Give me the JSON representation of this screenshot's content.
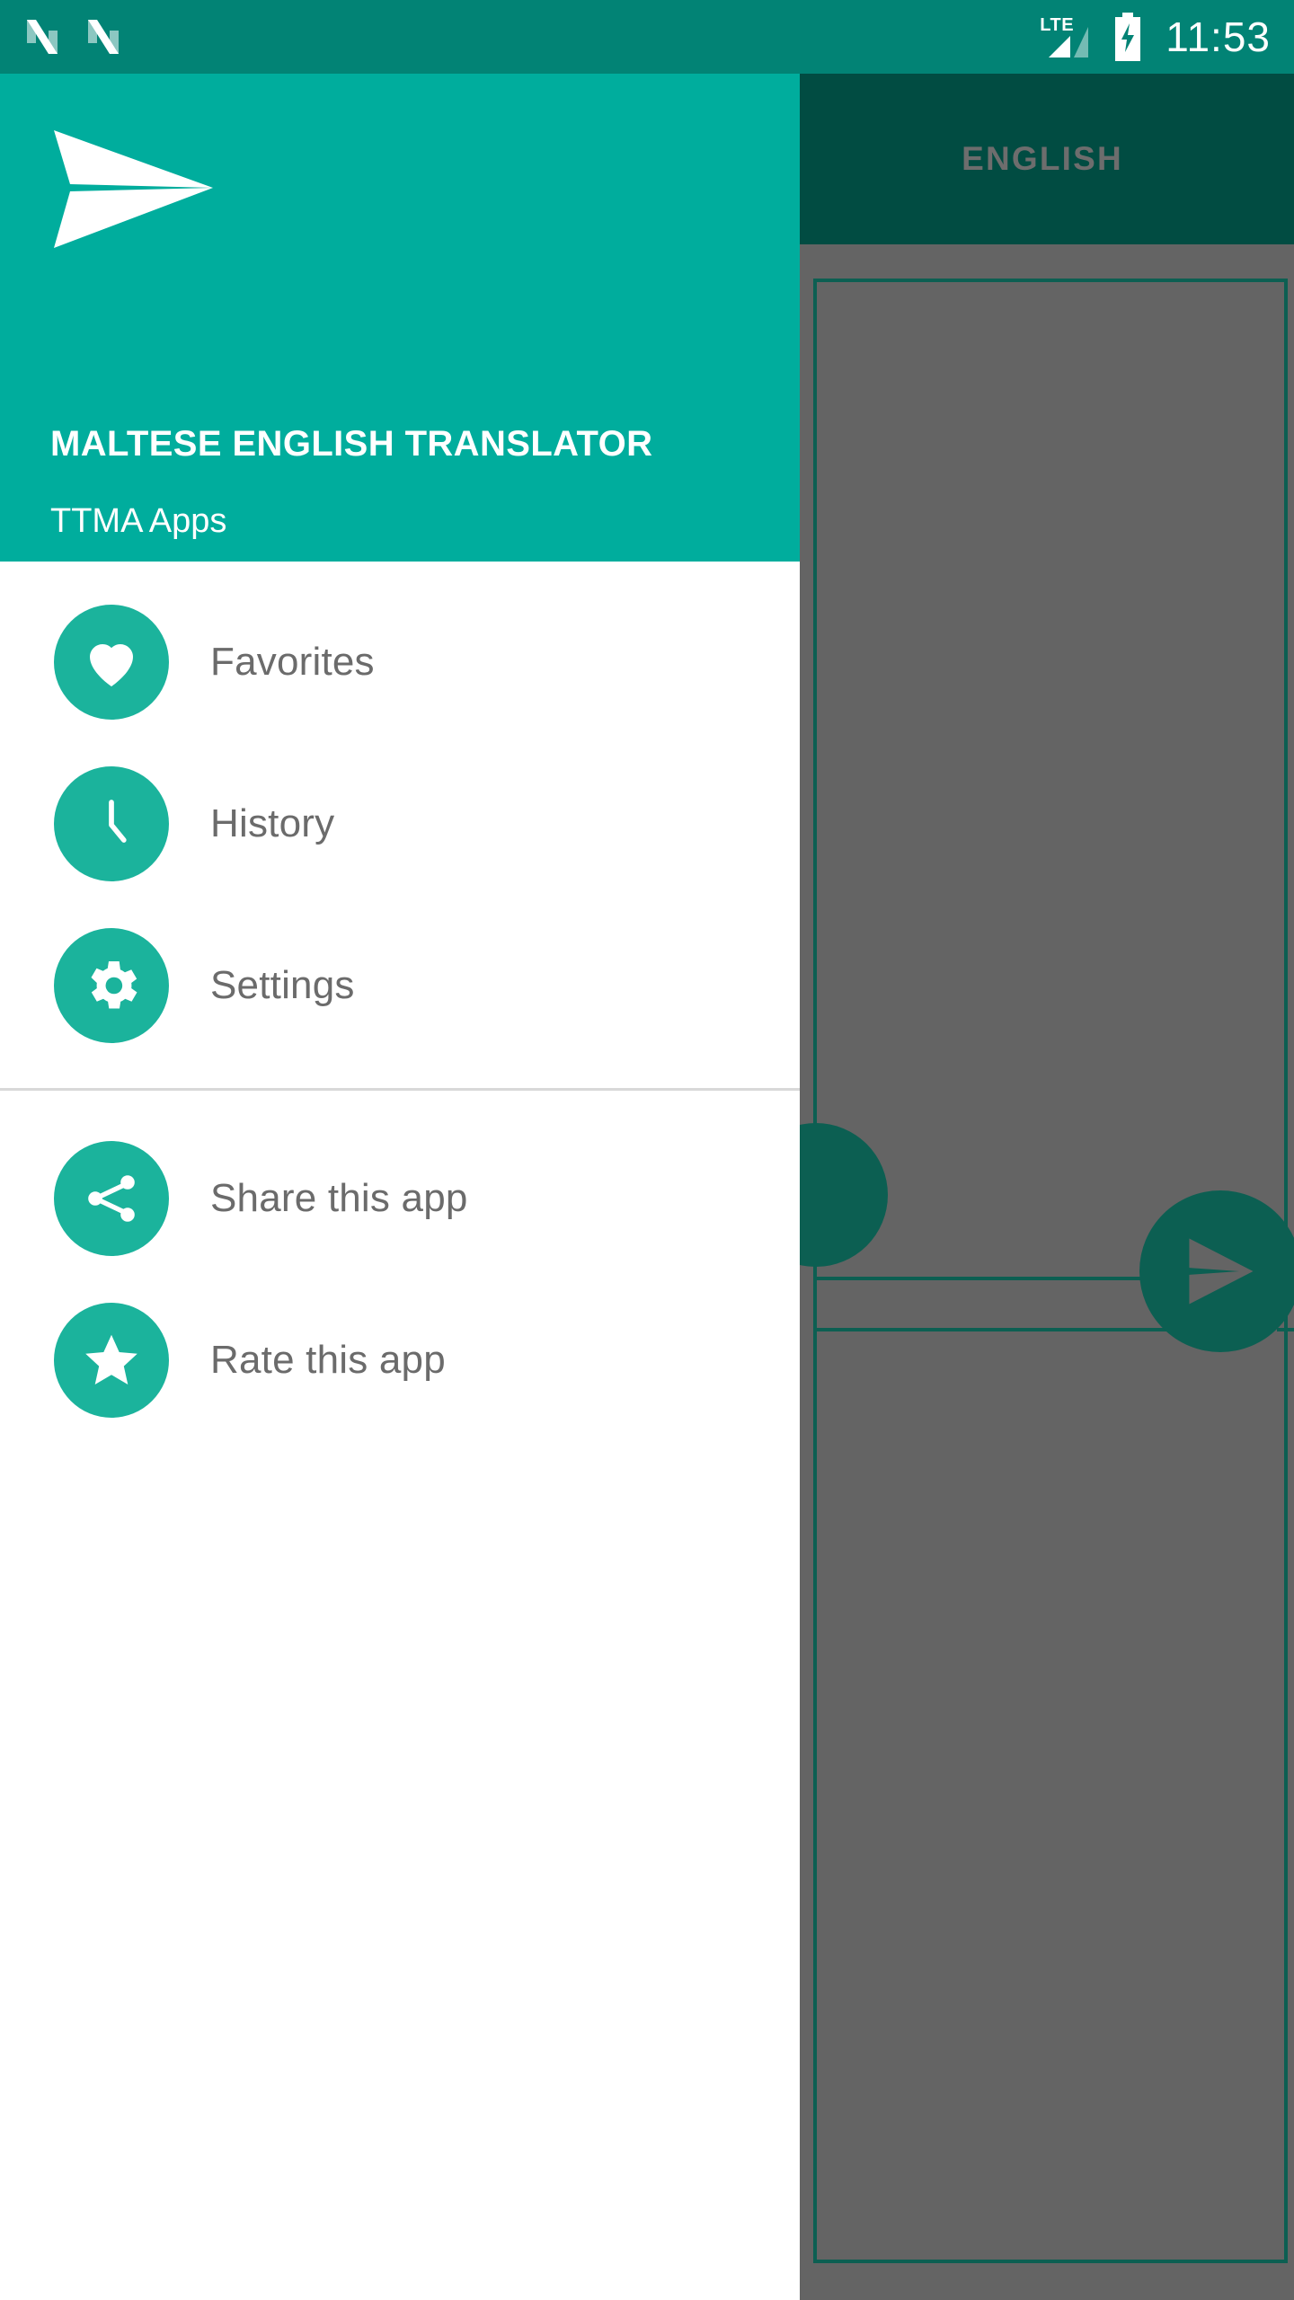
{
  "status_bar": {
    "notification_icons": [
      "android-n-icon",
      "android-n-icon"
    ],
    "network_label": "LTE",
    "signal_icon": "signal-triangle-icon",
    "battery_icon": "battery-charging-icon",
    "time": "11:53",
    "background_color": "#028375"
  },
  "drawer": {
    "logo_icon": "paper-plane-logo-icon",
    "title": "MALTESE ENGLISH TRANSLATOR",
    "subtitle": "TTMA Apps",
    "header_color": "#00ad9d",
    "primary_items": [
      {
        "label": "Favorites",
        "icon": "heart-icon"
      },
      {
        "label": "History",
        "icon": "clock-icon"
      },
      {
        "label": "Settings",
        "icon": "gear-icon"
      }
    ],
    "secondary_items": [
      {
        "label": "Share this app",
        "icon": "share-icon"
      },
      {
        "label": "Rate this app",
        "icon": "star-icon"
      }
    ],
    "icon_color": "#1bb39c",
    "label_color": "#6b6b6b"
  },
  "main": {
    "appbar_color": "#014c42",
    "scrim_color": "#646464",
    "tab_label": "ENGLISH",
    "panel_border_color": "#0c5f52",
    "send_button_icon": "send-icon",
    "fab_color": "#0c5f52"
  }
}
